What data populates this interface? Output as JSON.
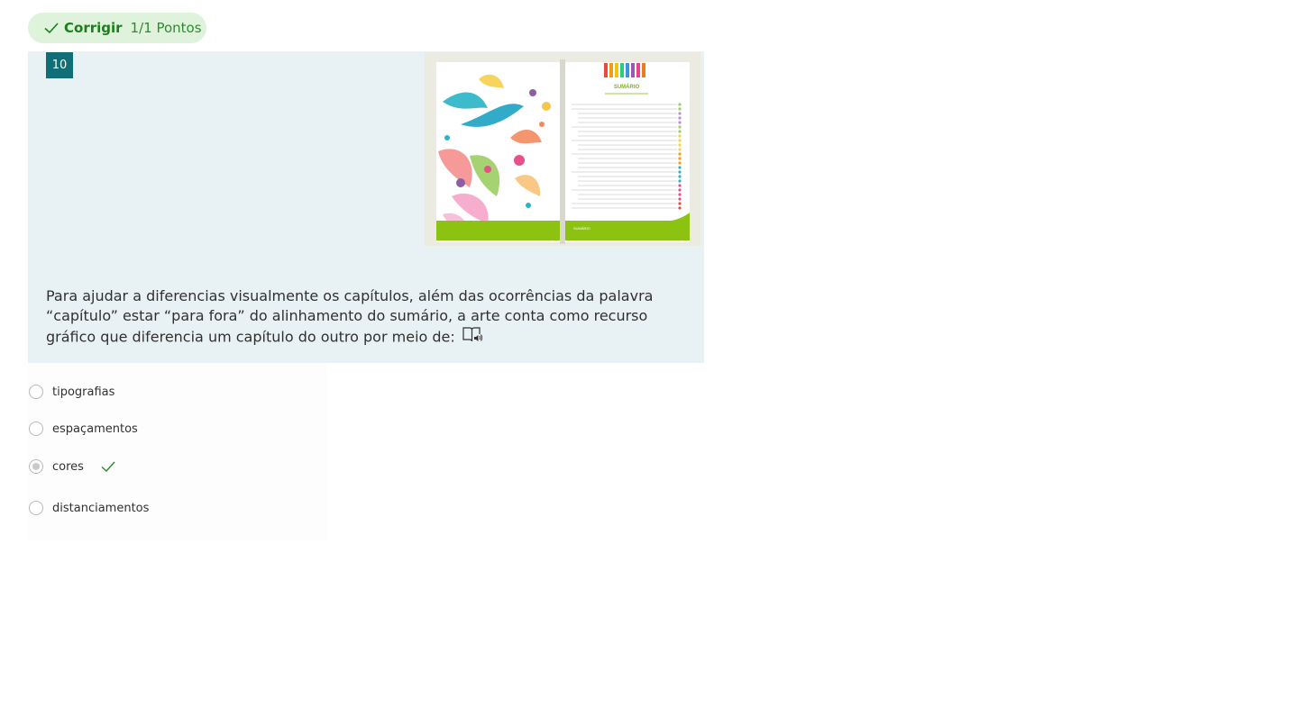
{
  "result": {
    "status_label": "Corrigir",
    "points_label": "1/1 Pontos",
    "status_color": "#1b7f1b"
  },
  "question": {
    "number": "10",
    "text": "Para ajudar a diferencias visualmente os capítulos, além das ocorrências da palavra “capítulo” estar “para fora” do alinhamento do sumário, a arte conta como recurso gráfico que diferencia um capítulo do outro por meio de:",
    "immersive_reader_icon": "immersive-reader-icon",
    "image": {
      "title": "SUMÁRIO",
      "footer": "SUMÁRIO"
    }
  },
  "choices": [
    {
      "label": "tipografias",
      "selected": false,
      "correct": false
    },
    {
      "label": "espaçamentos",
      "selected": false,
      "correct": false
    },
    {
      "label": "cores",
      "selected": true,
      "correct": true
    },
    {
      "label": "distanciamentos",
      "selected": false,
      "correct": false
    }
  ],
  "colors": {
    "accent": "#0f6e76",
    "success": "#2e8b2e",
    "card_bg": "#e8f1f4",
    "badge_bg": "#dff3dc"
  }
}
